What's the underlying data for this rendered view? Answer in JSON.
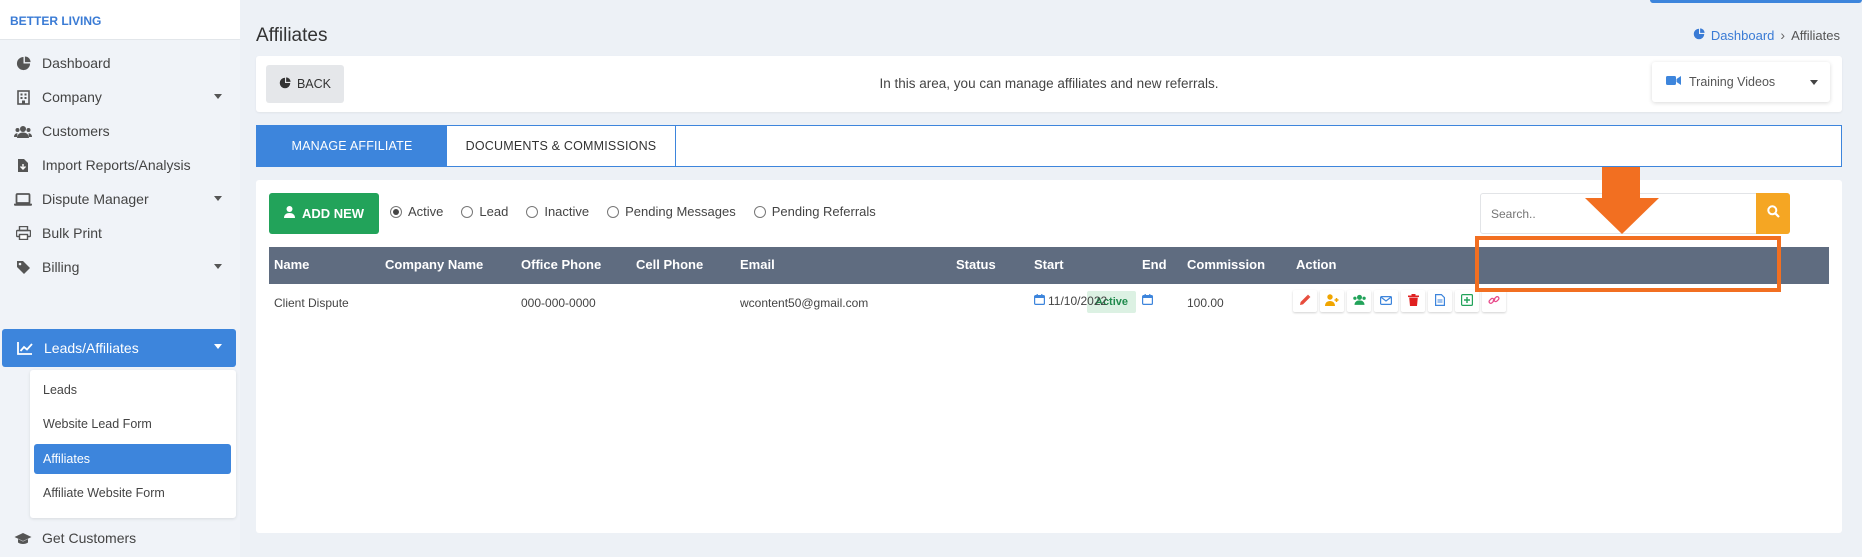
{
  "brand": "BETTER LIVING",
  "sidebar": {
    "items": [
      {
        "label": "Dashboard",
        "icon": "pie-chart-icon"
      },
      {
        "label": "Company",
        "icon": "building-icon"
      },
      {
        "label": "Customers",
        "icon": "users-icon"
      },
      {
        "label": "Import Reports/Analysis",
        "icon": "file-import-icon"
      },
      {
        "label": "Dispute Manager",
        "icon": "laptop-icon"
      },
      {
        "label": "Bulk Print",
        "icon": "printer-icon"
      },
      {
        "label": "Billing",
        "icon": "tag-icon"
      },
      {
        "label": "Leads/Affiliates",
        "icon": "line-chart-icon"
      },
      {
        "label": "Get Customers",
        "icon": "graduation-cap-icon"
      }
    ],
    "submenu": [
      {
        "label": "Leads"
      },
      {
        "label": "Website Lead Form"
      },
      {
        "label": "Affiliates"
      },
      {
        "label": "Affiliate Website Form"
      }
    ]
  },
  "header": {
    "title": "Affiliates",
    "breadcrumb": {
      "home": "Dashboard",
      "current": "Affiliates"
    }
  },
  "topbar": {
    "back_label": "BACK",
    "message": "In this area, you can manage affiliates and new referrals.",
    "videos_label": "Training Videos"
  },
  "tabs": [
    {
      "label": "MANAGE AFFILIATE"
    },
    {
      "label": "DOCUMENTS & COMMISSIONS"
    }
  ],
  "toolbar": {
    "add_label": "ADD NEW",
    "filters": [
      {
        "label": "Active",
        "checked": true
      },
      {
        "label": "Lead"
      },
      {
        "label": "Inactive"
      },
      {
        "label": "Pending Messages"
      },
      {
        "label": "Pending Referrals"
      }
    ],
    "search_placeholder": "Search.."
  },
  "table": {
    "columns": [
      "Name",
      "Company Name",
      "Office Phone",
      "Cell Phone",
      "Email",
      "Status",
      "Start",
      "End",
      "Commission",
      "Action"
    ],
    "rows": [
      {
        "name": "Client Dispute",
        "company": "",
        "office_phone": "000-000-0000",
        "cell_phone": "",
        "email": "wcontent50@gmail.com",
        "status": "Active",
        "start": "11/10/2022",
        "end": "",
        "commission": "100.00"
      }
    ],
    "action_icons": [
      "edit-icon",
      "add-user-icon",
      "group-icon",
      "envelope-icon",
      "trash-icon",
      "document-icon",
      "plus-square-icon",
      "link-icon"
    ]
  },
  "colors": {
    "primary": "#3d85dc",
    "success": "#22a35a",
    "warning": "#f5a623",
    "table_header": "#5f6c80",
    "annotation": "#f26f21"
  }
}
